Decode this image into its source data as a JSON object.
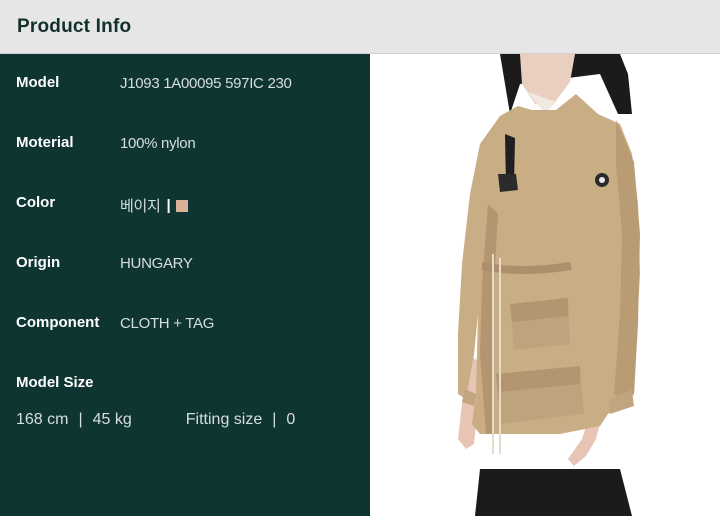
{
  "header": {
    "title": "Product Info"
  },
  "details": [
    {
      "label": "Model",
      "value": "J1093 1A00095 597IC 230"
    },
    {
      "label": "Moterial",
      "value": "100% nylon"
    },
    {
      "label": "Color",
      "value": "베이지"
    },
    {
      "label": "Origin",
      "value": "HUNGARY"
    },
    {
      "label": "Component",
      "value": "CLOTH + TAG"
    }
  ],
  "color_swatch": {
    "separator": "|",
    "hex": "#d8b196"
  },
  "model_size": {
    "label": "Model Size",
    "height": "168 cm",
    "separator": "|",
    "weight": "45 kg",
    "fitting_label": "Fitting size",
    "fitting_separator": "|",
    "fitting_value": "0"
  }
}
